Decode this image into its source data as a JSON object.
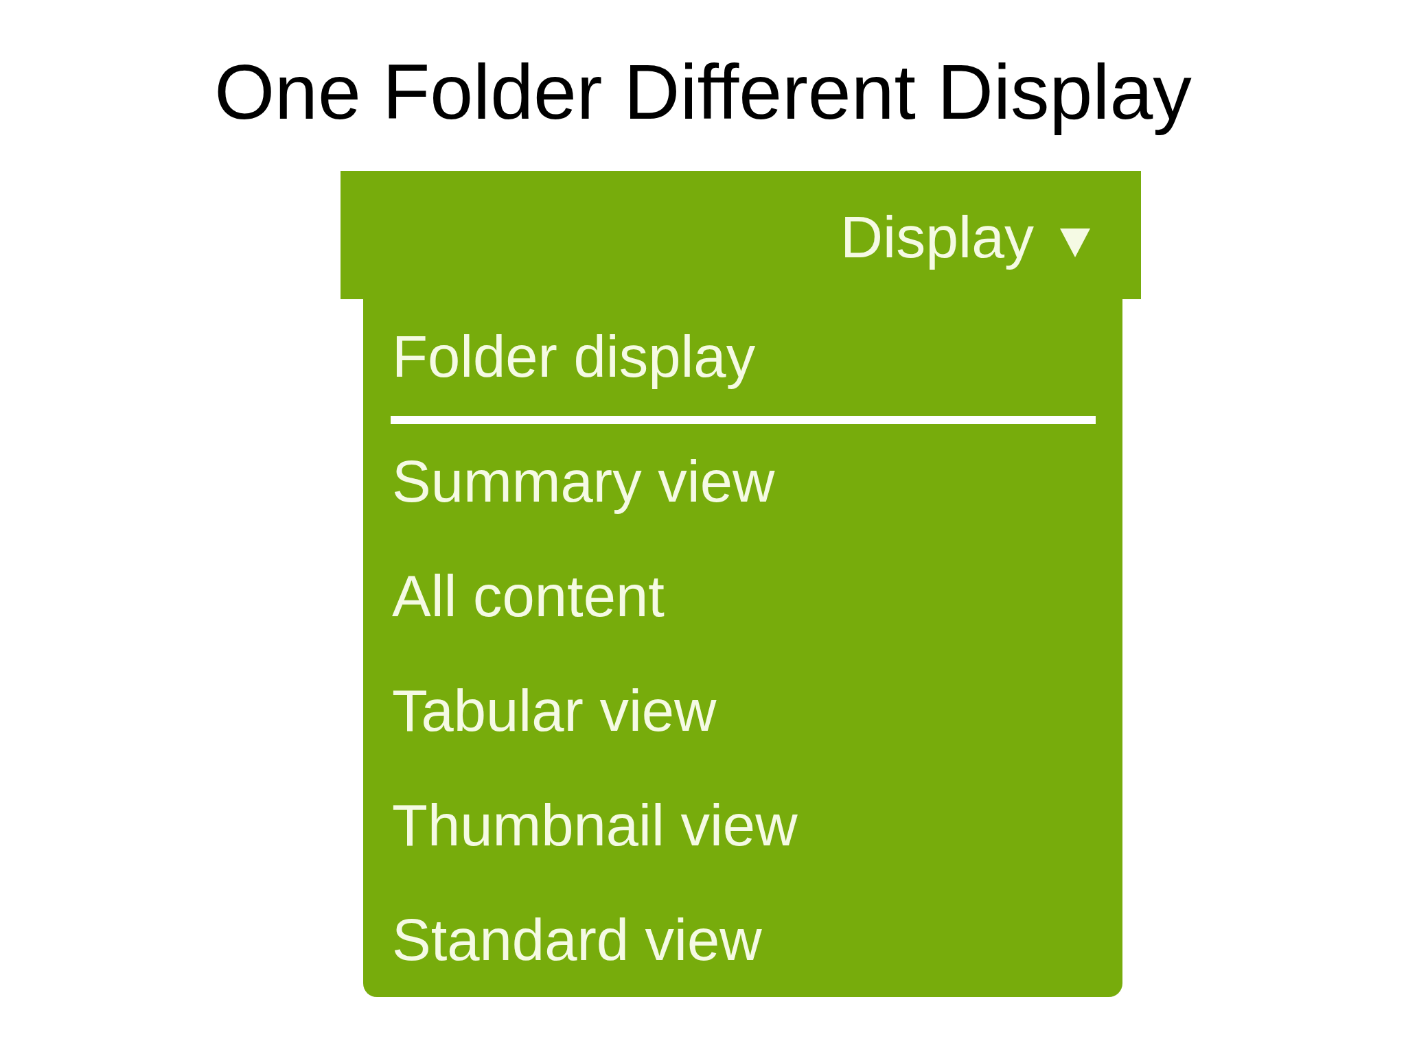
{
  "slide": {
    "title": "One Folder Different Display"
  },
  "dropdown": {
    "label": "Display",
    "expanded": true,
    "heading": "Folder display",
    "items": [
      {
        "label": "Summary view"
      },
      {
        "label": "All content"
      },
      {
        "label": "Tabular view"
      },
      {
        "label": "Thumbnail view"
      },
      {
        "label": "Standard view"
      }
    ]
  }
}
